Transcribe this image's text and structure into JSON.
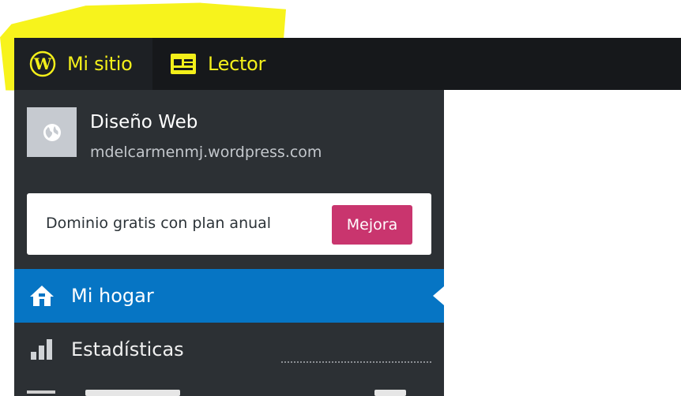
{
  "topbar": {
    "my_site_label": "Mi sitio",
    "reader_label": "Lector",
    "accent_color": "#f3ef1a",
    "highlight_color": "#f7f31c"
  },
  "site": {
    "title": "Diseño Web",
    "url": "mdelcarmenmj.wordpress.com"
  },
  "upgrade": {
    "text": "Dominio gratis con plan anual",
    "button_label": "Mejora",
    "button_color": "#c9356e"
  },
  "nav": {
    "items": [
      {
        "label": "Mi hogar",
        "icon": "home-icon",
        "active": true
      },
      {
        "label": "Estadísticas",
        "icon": "bar-chart-icon",
        "active": false
      }
    ],
    "active_color": "#0675c4"
  }
}
